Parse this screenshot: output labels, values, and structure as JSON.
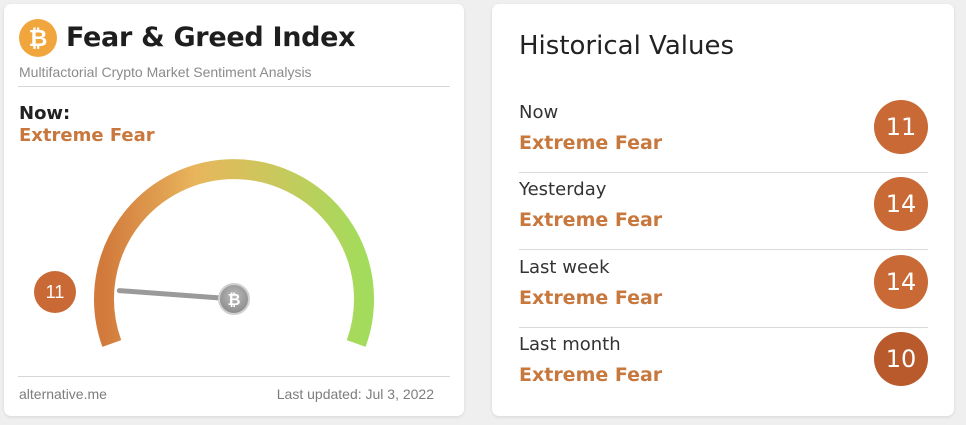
{
  "index_card": {
    "logo_icon": "bitcoin-icon",
    "title": "Fear & Greed Index",
    "subtitle": "Multifactorial Crypto Market Sentiment Analysis",
    "now_label": "Now:",
    "now_status": "Extreme Fear",
    "gauge": {
      "value": 11,
      "min": 0,
      "max": 100,
      "colors": {
        "fear": "#d27a3c",
        "mid": "#e8b55c",
        "greed": "#a3dc5c"
      }
    },
    "value_label": "11",
    "footer_source": "alternative.me",
    "footer_updated": "Last updated: Jul 3, 2022"
  },
  "historical": {
    "title": "Historical Values",
    "rows": [
      {
        "label": "Now",
        "status": "Extreme Fear",
        "value": "11"
      },
      {
        "label": "Yesterday",
        "status": "Extreme Fear",
        "value": "14"
      },
      {
        "label": "Last week",
        "status": "Extreme Fear",
        "value": "14"
      },
      {
        "label": "Last month",
        "status": "Extreme Fear",
        "value": "10"
      }
    ]
  },
  "colors": {
    "accent": "#c8773d",
    "bubble": "#c96936",
    "bitcoin_orange": "#f0a63c"
  }
}
